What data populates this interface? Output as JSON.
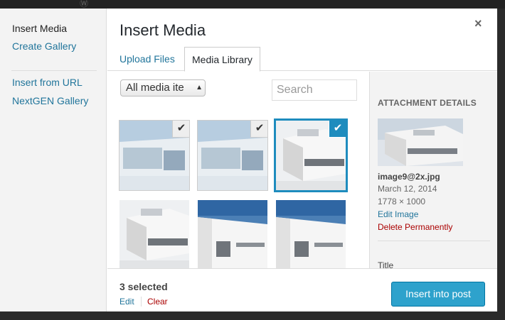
{
  "menu": {
    "active_item": "Insert Media",
    "items": [
      "Create Gallery",
      "Insert from URL",
      "NextGEN Gallery"
    ]
  },
  "modal": {
    "title": "Insert Media",
    "close_glyph": "×",
    "tabs": [
      "Upload Files",
      "Media Library"
    ],
    "active_tab": "Media Library"
  },
  "browser": {
    "filter_value": "All media ite",
    "search_placeholder": "Search",
    "check_glyph": "✔",
    "thumbnails": [
      {
        "selected": true,
        "active": false,
        "image": "building-top-view"
      },
      {
        "selected": true,
        "active": false,
        "image": "building-top-view"
      },
      {
        "selected": true,
        "active": true,
        "image": "building-corner"
      },
      {
        "selected": false,
        "active": false,
        "image": "building-corner"
      },
      {
        "selected": false,
        "active": false,
        "image": "building-street"
      },
      {
        "selected": false,
        "active": false,
        "image": "building-street"
      }
    ]
  },
  "details": {
    "heading": "ATTACHMENT DETAILS",
    "filename": "image9@2x.jpg",
    "date": "March 12, 2014",
    "dimensions": "1778 × 1000",
    "edit_link": "Edit Image",
    "delete_link": "Delete Permanently",
    "title_label": "Title"
  },
  "toolbar": {
    "selection_count": "3 selected",
    "edit_link": "Edit",
    "clear_link": "Clear",
    "insert_button": "Insert into post"
  },
  "colors": {
    "accent": "#1e8cbe",
    "button": "#2ea2cc",
    "link": "#21759b",
    "danger": "#aa0000"
  }
}
